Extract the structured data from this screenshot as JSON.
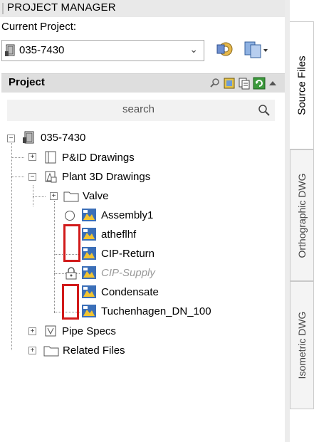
{
  "panel": {
    "title": "PROJECT MANAGER"
  },
  "current_project": {
    "label": "Current Project:",
    "value": "035-7430"
  },
  "project_section": {
    "header": "Project",
    "search_placeholder": "search"
  },
  "tree": {
    "root": "035-7430",
    "pid": "P&ID Drawings",
    "plant3d": "Plant 3D Drawings",
    "valve": "Valve",
    "assembly": "Assembly1",
    "atheflhf": "atheflhf",
    "cipreturn": "CIP-Return",
    "cipsupply": "CIP-Supply",
    "condensate": "Condensate",
    "tuchen": "Tuchenhagen_DN_100",
    "pipespecs": "Pipe Specs",
    "related": "Related Files"
  },
  "side_tabs": {
    "source": "Source Files",
    "ortho": "Orthographic DWG",
    "iso": "Isometric DWG"
  },
  "colors": {
    "highlight_box": "#d11a1a",
    "header_bg": "#dedede"
  }
}
